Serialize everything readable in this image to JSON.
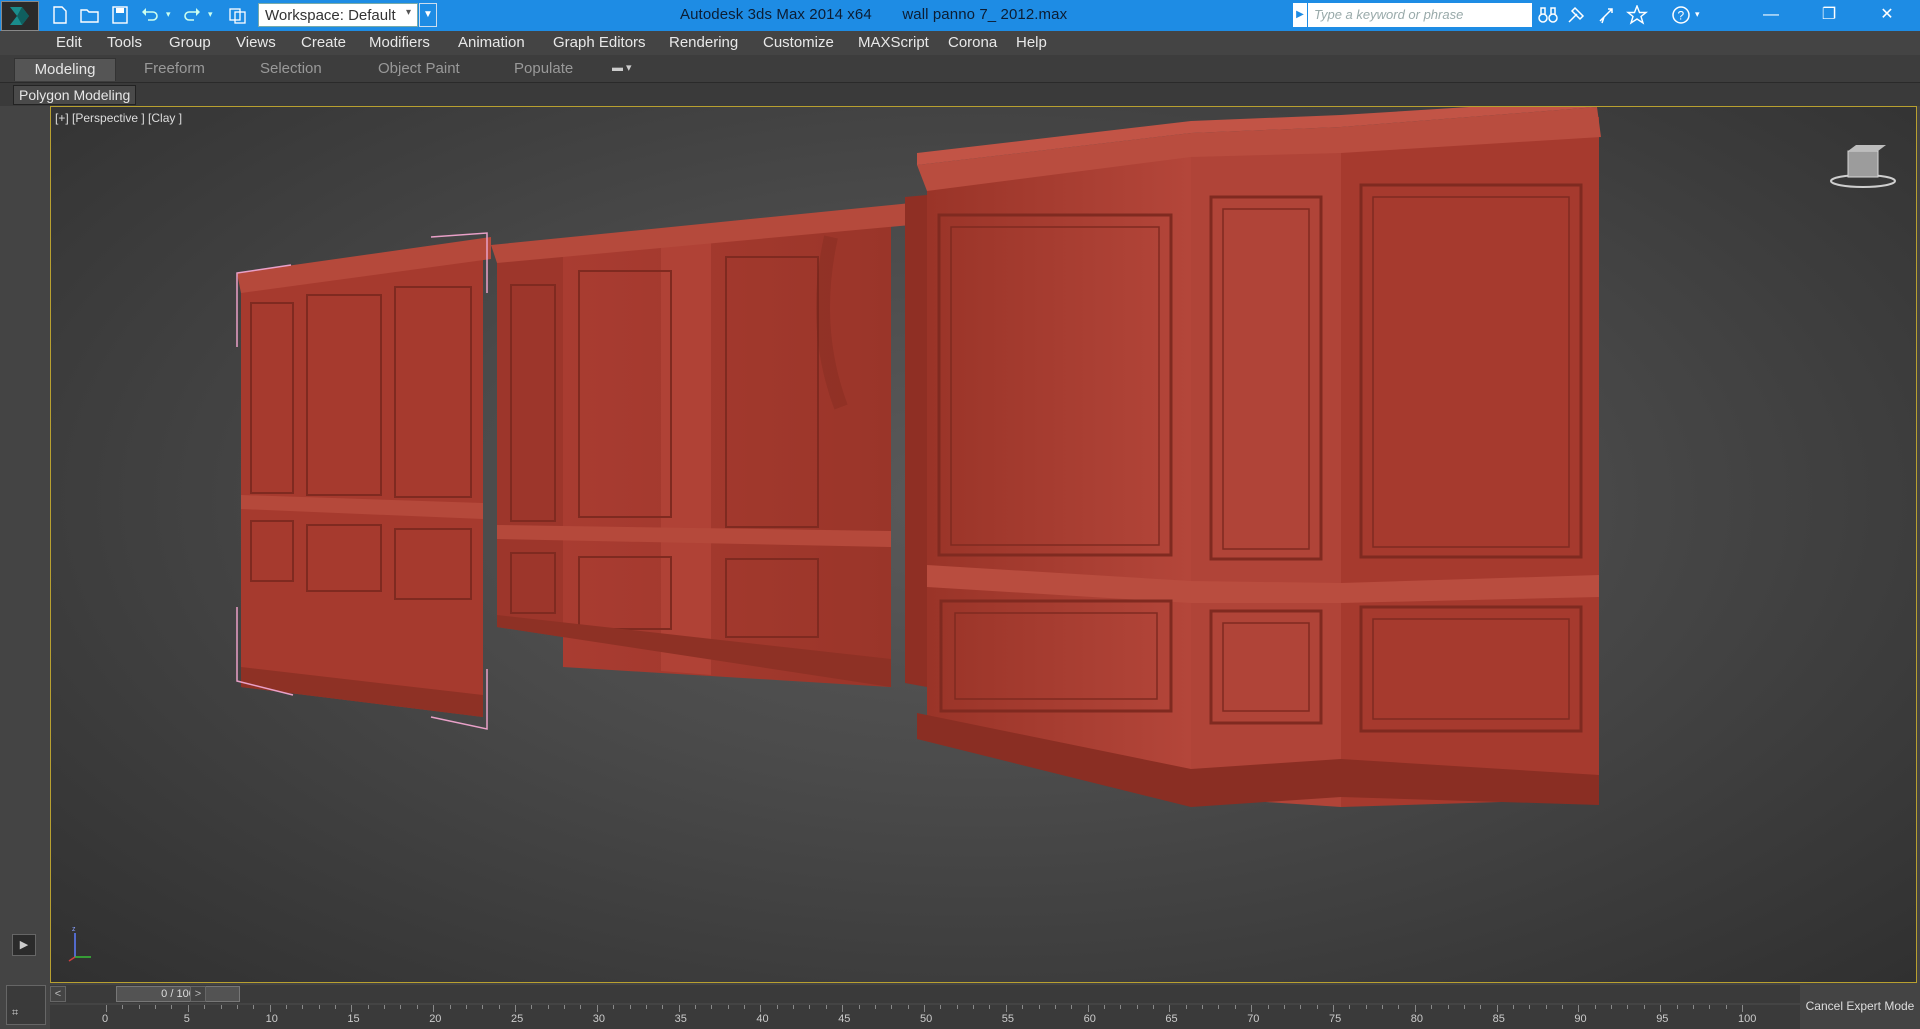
{
  "titlebar": {
    "app_name": "Autodesk 3ds Max  2014 x64",
    "file_name": "wall panno 7_ 2012.max",
    "workspace_label": "Workspace: Default",
    "search_placeholder": "Type a keyword or phrase"
  },
  "menubar": {
    "items": [
      "Edit",
      "Tools",
      "Group",
      "Views",
      "Create",
      "Modifiers",
      "Animation",
      "Graph Editors",
      "Rendering",
      "Customize",
      "MAXScript",
      "Corona",
      "Help"
    ]
  },
  "ribbon": {
    "tabs": [
      "Modeling",
      "Freeform",
      "Selection",
      "Object Paint",
      "Populate"
    ],
    "active_tab": "Modeling",
    "panel_label": "Polygon Modeling"
  },
  "viewport": {
    "label": "[+] [Perspective ] [Clay ]",
    "panel_color": "#a63a2e"
  },
  "timeline": {
    "frame_display": "0 / 100",
    "ticks": [
      "0",
      "5",
      "10",
      "15",
      "20",
      "25",
      "30",
      "35",
      "40",
      "45",
      "50",
      "55",
      "60",
      "65",
      "70",
      "75",
      "80",
      "85",
      "90",
      "95",
      "100"
    ],
    "cancel_expert": "Cancel Expert Mode"
  },
  "colors": {
    "titlebar": "#1e8ce4",
    "ui_dark": "#444444",
    "viewport_border": "#b8a030"
  }
}
